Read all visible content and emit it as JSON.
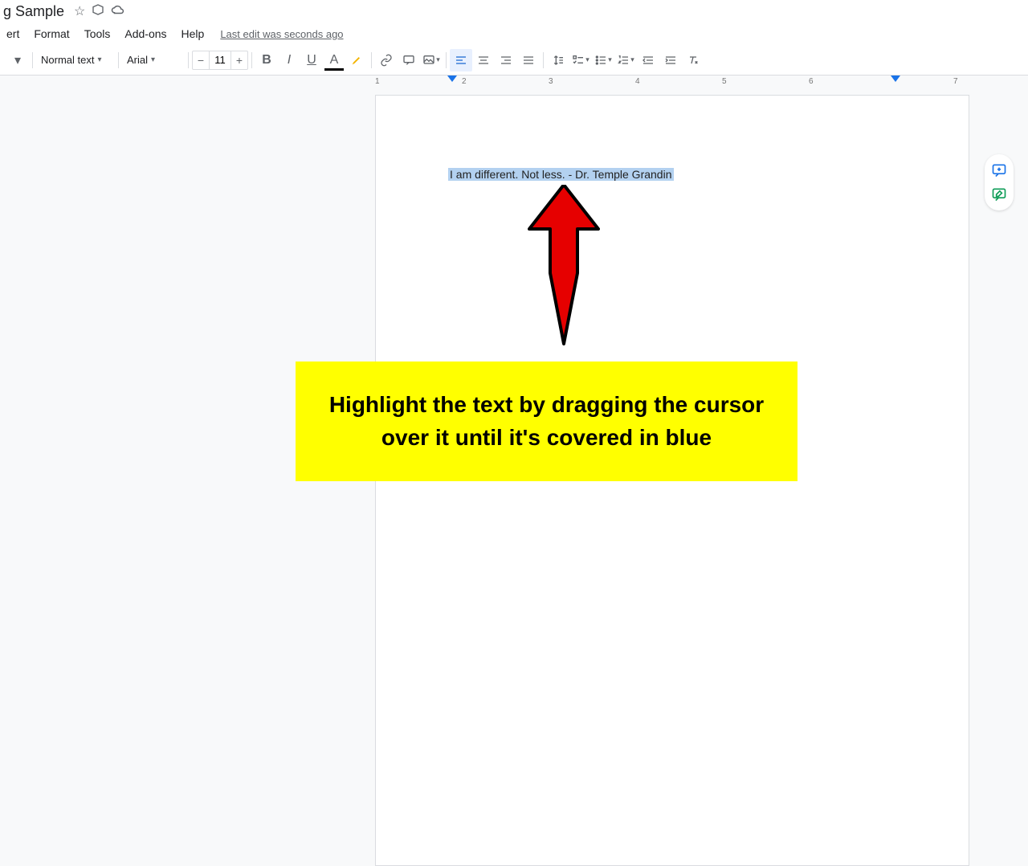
{
  "header": {
    "doc_title": "g Sample",
    "last_edit": "Last edit was seconds ago"
  },
  "menu": {
    "items": [
      "ert",
      "Format",
      "Tools",
      "Add-ons",
      "Help"
    ]
  },
  "toolbar": {
    "style_select": "Normal text",
    "font_select": "Arial",
    "font_size": "11"
  },
  "ruler": {
    "marks": [
      "1",
      "2",
      "3",
      "4",
      "5",
      "6",
      "7"
    ]
  },
  "document": {
    "selected_text": "I am different. Not less. - Dr. Temple Grandin"
  },
  "annotation": {
    "text": "Highlight the text by dragging the cursor over it until it's covered in blue"
  },
  "colors": {
    "accent": "#1a73e8",
    "highlight_yellow": "#ffff00",
    "arrow_red": "#e60000",
    "selection_blue": "#b3d1f0"
  }
}
